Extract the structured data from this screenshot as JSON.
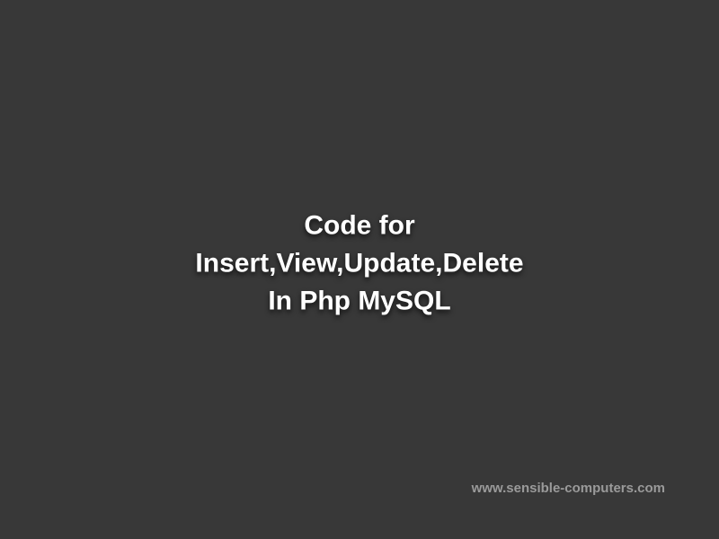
{
  "title": {
    "line1": "Code for",
    "line2": "Insert,View,Update,Delete",
    "line3": "In Php MySQL"
  },
  "watermark": "www.sensible-computers.com"
}
